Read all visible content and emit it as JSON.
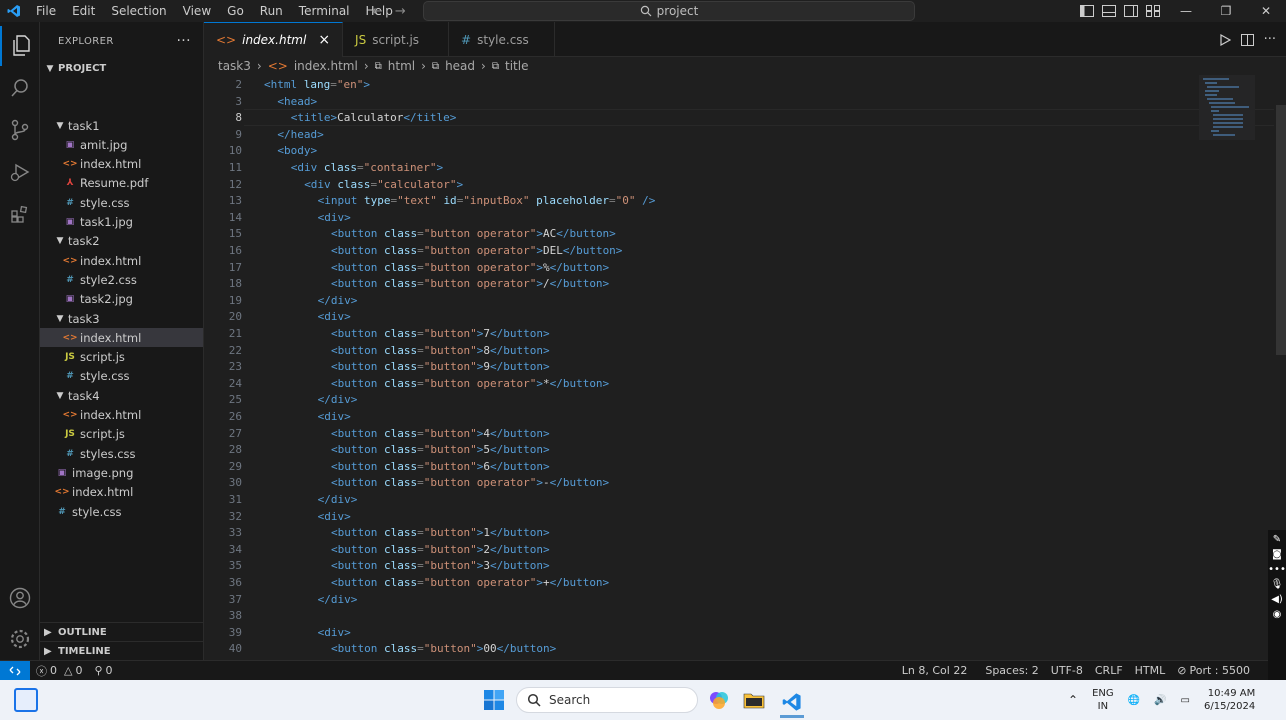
{
  "menu": [
    "File",
    "Edit",
    "Selection",
    "View",
    "Go",
    "Run",
    "Terminal",
    "Help"
  ],
  "search": {
    "text": "project"
  },
  "explorer": {
    "title": "EXPLORER",
    "project": "PROJECT",
    "rows": [
      {
        "label": "task1",
        "kind": "folder",
        "depth": 1
      },
      {
        "label": "amit.jpg",
        "kind": "img",
        "depth": 2
      },
      {
        "label": "index.html",
        "kind": "html",
        "depth": 2
      },
      {
        "label": "Resume.pdf",
        "kind": "pdf",
        "depth": 2
      },
      {
        "label": "style.css",
        "kind": "css",
        "depth": 2
      },
      {
        "label": "task1.jpg",
        "kind": "img",
        "depth": 2
      },
      {
        "label": "task2",
        "kind": "folder",
        "depth": 1
      },
      {
        "label": "index.html",
        "kind": "html",
        "depth": 2
      },
      {
        "label": "style2.css",
        "kind": "css",
        "depth": 2
      },
      {
        "label": "task2.jpg",
        "kind": "img",
        "depth": 2
      },
      {
        "label": "task3",
        "kind": "folder",
        "depth": 1
      },
      {
        "label": "index.html",
        "kind": "html",
        "depth": 2,
        "selected": true
      },
      {
        "label": "script.js",
        "kind": "js",
        "depth": 2
      },
      {
        "label": "style.css",
        "kind": "css",
        "depth": 2
      },
      {
        "label": "task4",
        "kind": "folder",
        "depth": 1
      },
      {
        "label": "index.html",
        "kind": "html",
        "depth": 2
      },
      {
        "label": "script.js",
        "kind": "js",
        "depth": 2
      },
      {
        "label": "styles.css",
        "kind": "css",
        "depth": 2
      },
      {
        "label": "image.png",
        "kind": "img",
        "depth": 1
      },
      {
        "label": "index.html",
        "kind": "html",
        "depth": 1
      },
      {
        "label": "style.css",
        "kind": "css",
        "depth": 1
      }
    ],
    "outline": "OUTLINE",
    "timeline": "TIMELINE"
  },
  "tabs": [
    {
      "label": "index.html",
      "kind": "html",
      "active": true,
      "close": "×"
    },
    {
      "label": "script.js",
      "kind": "js",
      "active": false,
      "close": ""
    },
    {
      "label": "style.css",
      "kind": "css",
      "active": false,
      "close": ""
    }
  ],
  "breadcrumb": [
    "task3",
    "index.html",
    "html",
    "head",
    "title"
  ],
  "code": [
    {
      "n": "2",
      "indent": 0,
      "tokens": [
        [
          "tag",
          "<html "
        ],
        [
          "atr",
          "lang"
        ],
        [
          "pun",
          "="
        ],
        [
          "str",
          "\"en\""
        ],
        [
          "tag",
          ">"
        ]
      ]
    },
    {
      "n": "3",
      "indent": 1,
      "tokens": [
        [
          "tag",
          "<head>"
        ]
      ]
    },
    {
      "n": "8",
      "indent": 2,
      "current": true,
      "tokens": [
        [
          "tag",
          "<title>"
        ],
        [
          "txt",
          "Calculator"
        ],
        [
          "tag",
          "</title>"
        ]
      ]
    },
    {
      "n": "9",
      "indent": 1,
      "tokens": [
        [
          "tag",
          "</head>"
        ]
      ]
    },
    {
      "n": "10",
      "indent": 1,
      "tokens": [
        [
          "tag",
          "<body>"
        ]
      ]
    },
    {
      "n": "11",
      "indent": 2,
      "tokens": [
        [
          "tag",
          "<div "
        ],
        [
          "atr",
          "class"
        ],
        [
          "pun",
          "="
        ],
        [
          "str",
          "\"container\""
        ],
        [
          "tag",
          ">"
        ]
      ]
    },
    {
      "n": "12",
      "indent": 3,
      "tokens": [
        [
          "tag",
          "<div "
        ],
        [
          "atr",
          "class"
        ],
        [
          "pun",
          "="
        ],
        [
          "str",
          "\"calculator\""
        ],
        [
          "tag",
          ">"
        ]
      ]
    },
    {
      "n": "13",
      "indent": 4,
      "tokens": [
        [
          "tag",
          "<input "
        ],
        [
          "atr",
          "type"
        ],
        [
          "pun",
          "="
        ],
        [
          "str",
          "\"text\" "
        ],
        [
          "atr",
          "id"
        ],
        [
          "pun",
          "="
        ],
        [
          "str",
          "\"inputBox\" "
        ],
        [
          "atr",
          "placeholder"
        ],
        [
          "pun",
          "="
        ],
        [
          "str",
          "\"0\" "
        ],
        [
          "tag",
          "/>"
        ]
      ]
    },
    {
      "n": "14",
      "indent": 4,
      "tokens": [
        [
          "tag",
          "<div>"
        ]
      ]
    },
    {
      "n": "15",
      "indent": 5,
      "tokens": [
        [
          "tag",
          "<button "
        ],
        [
          "atr",
          "class"
        ],
        [
          "pun",
          "="
        ],
        [
          "str",
          "\"button operator\""
        ],
        [
          "tag",
          ">"
        ],
        [
          "txt",
          "AC"
        ],
        [
          "tag",
          "</button>"
        ]
      ]
    },
    {
      "n": "16",
      "indent": 5,
      "tokens": [
        [
          "tag",
          "<button "
        ],
        [
          "atr",
          "class"
        ],
        [
          "pun",
          "="
        ],
        [
          "str",
          "\"button operator\""
        ],
        [
          "tag",
          ">"
        ],
        [
          "txt",
          "DEL"
        ],
        [
          "tag",
          "</button>"
        ]
      ]
    },
    {
      "n": "17",
      "indent": 5,
      "tokens": [
        [
          "tag",
          "<button "
        ],
        [
          "atr",
          "class"
        ],
        [
          "pun",
          "="
        ],
        [
          "str",
          "\"button operator\""
        ],
        [
          "tag",
          ">"
        ],
        [
          "txt",
          "%"
        ],
        [
          "tag",
          "</button>"
        ]
      ]
    },
    {
      "n": "18",
      "indent": 5,
      "tokens": [
        [
          "tag",
          "<button "
        ],
        [
          "atr",
          "class"
        ],
        [
          "pun",
          "="
        ],
        [
          "str",
          "\"button operator\""
        ],
        [
          "tag",
          ">"
        ],
        [
          "txt",
          "/"
        ],
        [
          "tag",
          "</button>"
        ]
      ]
    },
    {
      "n": "19",
      "indent": 4,
      "tokens": [
        [
          "tag",
          "</div>"
        ]
      ]
    },
    {
      "n": "20",
      "indent": 4,
      "tokens": [
        [
          "tag",
          "<div>"
        ]
      ]
    },
    {
      "n": "21",
      "indent": 5,
      "tokens": [
        [
          "tag",
          "<button "
        ],
        [
          "atr",
          "class"
        ],
        [
          "pun",
          "="
        ],
        [
          "str",
          "\"button\""
        ],
        [
          "tag",
          ">"
        ],
        [
          "txt",
          "7"
        ],
        [
          "tag",
          "</button>"
        ]
      ]
    },
    {
      "n": "22",
      "indent": 5,
      "tokens": [
        [
          "tag",
          "<button "
        ],
        [
          "atr",
          "class"
        ],
        [
          "pun",
          "="
        ],
        [
          "str",
          "\"button\""
        ],
        [
          "tag",
          ">"
        ],
        [
          "txt",
          "8"
        ],
        [
          "tag",
          "</button>"
        ]
      ]
    },
    {
      "n": "23",
      "indent": 5,
      "tokens": [
        [
          "tag",
          "<button "
        ],
        [
          "atr",
          "class"
        ],
        [
          "pun",
          "="
        ],
        [
          "str",
          "\"button\""
        ],
        [
          "tag",
          ">"
        ],
        [
          "txt",
          "9"
        ],
        [
          "tag",
          "</button>"
        ]
      ]
    },
    {
      "n": "24",
      "indent": 5,
      "tokens": [
        [
          "tag",
          "<button "
        ],
        [
          "atr",
          "class"
        ],
        [
          "pun",
          "="
        ],
        [
          "str",
          "\"button operator\""
        ],
        [
          "tag",
          ">"
        ],
        [
          "txt",
          "*"
        ],
        [
          "tag",
          "</button>"
        ]
      ]
    },
    {
      "n": "25",
      "indent": 4,
      "tokens": [
        [
          "tag",
          "</div>"
        ]
      ]
    },
    {
      "n": "26",
      "indent": 4,
      "tokens": [
        [
          "tag",
          "<div>"
        ]
      ]
    },
    {
      "n": "27",
      "indent": 5,
      "tokens": [
        [
          "tag",
          "<button "
        ],
        [
          "atr",
          "class"
        ],
        [
          "pun",
          "="
        ],
        [
          "str",
          "\"button\""
        ],
        [
          "tag",
          ">"
        ],
        [
          "txt",
          "4"
        ],
        [
          "tag",
          "</button>"
        ]
      ]
    },
    {
      "n": "28",
      "indent": 5,
      "tokens": [
        [
          "tag",
          "<button "
        ],
        [
          "atr",
          "class"
        ],
        [
          "pun",
          "="
        ],
        [
          "str",
          "\"button\""
        ],
        [
          "tag",
          ">"
        ],
        [
          "txt",
          "5"
        ],
        [
          "tag",
          "</button>"
        ]
      ]
    },
    {
      "n": "29",
      "indent": 5,
      "tokens": [
        [
          "tag",
          "<button "
        ],
        [
          "atr",
          "class"
        ],
        [
          "pun",
          "="
        ],
        [
          "str",
          "\"button\""
        ],
        [
          "tag",
          ">"
        ],
        [
          "txt",
          "6"
        ],
        [
          "tag",
          "</button>"
        ]
      ]
    },
    {
      "n": "30",
      "indent": 5,
      "tokens": [
        [
          "tag",
          "<button "
        ],
        [
          "atr",
          "class"
        ],
        [
          "pun",
          "="
        ],
        [
          "str",
          "\"button operator\""
        ],
        [
          "tag",
          ">"
        ],
        [
          "txt",
          "-"
        ],
        [
          "tag",
          "</button>"
        ]
      ]
    },
    {
      "n": "31",
      "indent": 4,
      "tokens": [
        [
          "tag",
          "</div>"
        ]
      ]
    },
    {
      "n": "32",
      "indent": 4,
      "tokens": [
        [
          "tag",
          "<div>"
        ]
      ]
    },
    {
      "n": "33",
      "indent": 5,
      "tokens": [
        [
          "tag",
          "<button "
        ],
        [
          "atr",
          "class"
        ],
        [
          "pun",
          "="
        ],
        [
          "str",
          "\"button\""
        ],
        [
          "tag",
          ">"
        ],
        [
          "txt",
          "1"
        ],
        [
          "tag",
          "</button>"
        ]
      ]
    },
    {
      "n": "34",
      "indent": 5,
      "tokens": [
        [
          "tag",
          "<button "
        ],
        [
          "atr",
          "class"
        ],
        [
          "pun",
          "="
        ],
        [
          "str",
          "\"button\""
        ],
        [
          "tag",
          ">"
        ],
        [
          "txt",
          "2"
        ],
        [
          "tag",
          "</button>"
        ]
      ]
    },
    {
      "n": "35",
      "indent": 5,
      "tokens": [
        [
          "tag",
          "<button "
        ],
        [
          "atr",
          "class"
        ],
        [
          "pun",
          "="
        ],
        [
          "str",
          "\"button\""
        ],
        [
          "tag",
          ">"
        ],
        [
          "txt",
          "3"
        ],
        [
          "tag",
          "</button>"
        ]
      ]
    },
    {
      "n": "36",
      "indent": 5,
      "tokens": [
        [
          "tag",
          "<button "
        ],
        [
          "atr",
          "class"
        ],
        [
          "pun",
          "="
        ],
        [
          "str",
          "\"button operator\""
        ],
        [
          "tag",
          ">"
        ],
        [
          "txt",
          "+"
        ],
        [
          "tag",
          "</button>"
        ]
      ]
    },
    {
      "n": "37",
      "indent": 4,
      "tokens": [
        [
          "tag",
          "</div>"
        ]
      ]
    },
    {
      "n": "38",
      "indent": 0,
      "tokens": []
    },
    {
      "n": "39",
      "indent": 4,
      "tokens": [
        [
          "tag",
          "<div>"
        ]
      ]
    },
    {
      "n": "40",
      "indent": 5,
      "tokens": [
        [
          "tag",
          "<button "
        ],
        [
          "atr",
          "class"
        ],
        [
          "pun",
          "="
        ],
        [
          "str",
          "\"button\""
        ],
        [
          "tag",
          ">"
        ],
        [
          "txt",
          "00"
        ],
        [
          "tag",
          "</button>"
        ]
      ]
    }
  ],
  "status": {
    "remote": "><",
    "errors": "0",
    "warnings": "0",
    "ports_count": "0",
    "position": "Ln 8, Col 22",
    "spaces": "Spaces: 2",
    "encoding": "UTF-8",
    "eol": "CRLF",
    "language": "HTML",
    "port": "Port : 5500"
  },
  "taskbar": {
    "search": "Search",
    "lang1": "ENG",
    "lang2": "IN",
    "time": "10:49 AM",
    "date": "6/15/2024"
  },
  "colors": {
    "accent": "#0078d4",
    "html": "#e37933",
    "css": "#519aba",
    "js": "#cbcb41",
    "img": "#a074c4",
    "pdf": "#e0443e"
  }
}
